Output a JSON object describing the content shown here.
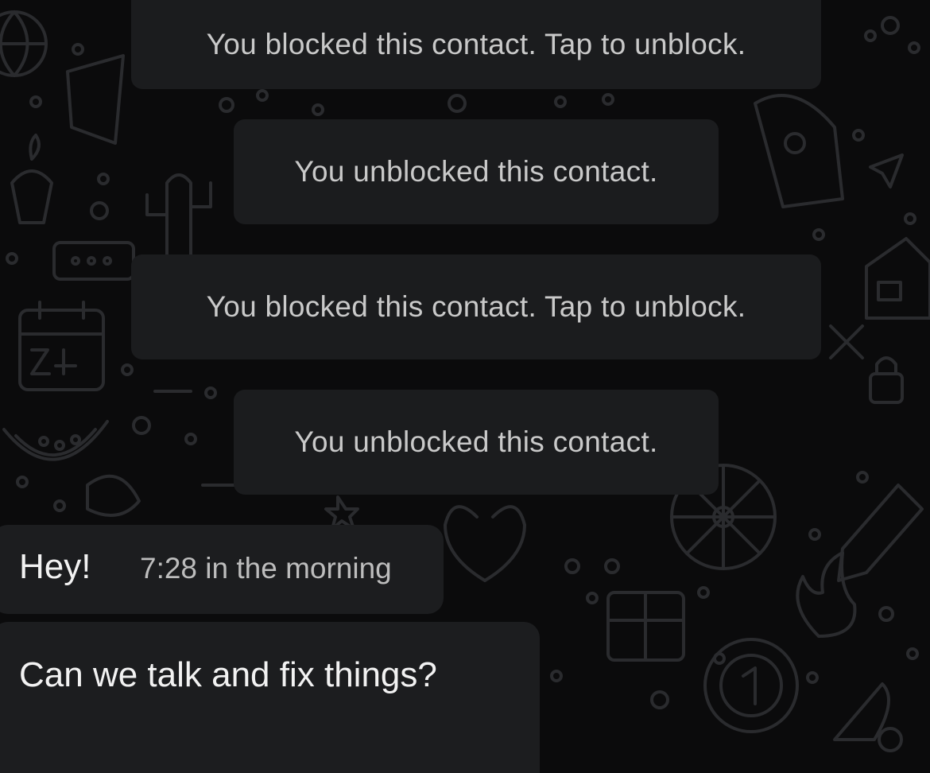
{
  "chat": {
    "system_messages": [
      "You blocked this contact. Tap to unblock.",
      "You unblocked this contact.",
      "You blocked this contact. Tap to unblock.",
      "You unblocked this contact."
    ],
    "messages": [
      {
        "text": "Hey!",
        "time": "7:28 in the morning"
      },
      {
        "text": "Can we talk and fix things?"
      }
    ]
  },
  "colors": {
    "background": "#0b0b0c",
    "bubble": "#1c1d1f",
    "system_text": "#c9c9c9",
    "message_text": "#f2f2f2",
    "doodle_stroke": "#2a2b2e"
  }
}
